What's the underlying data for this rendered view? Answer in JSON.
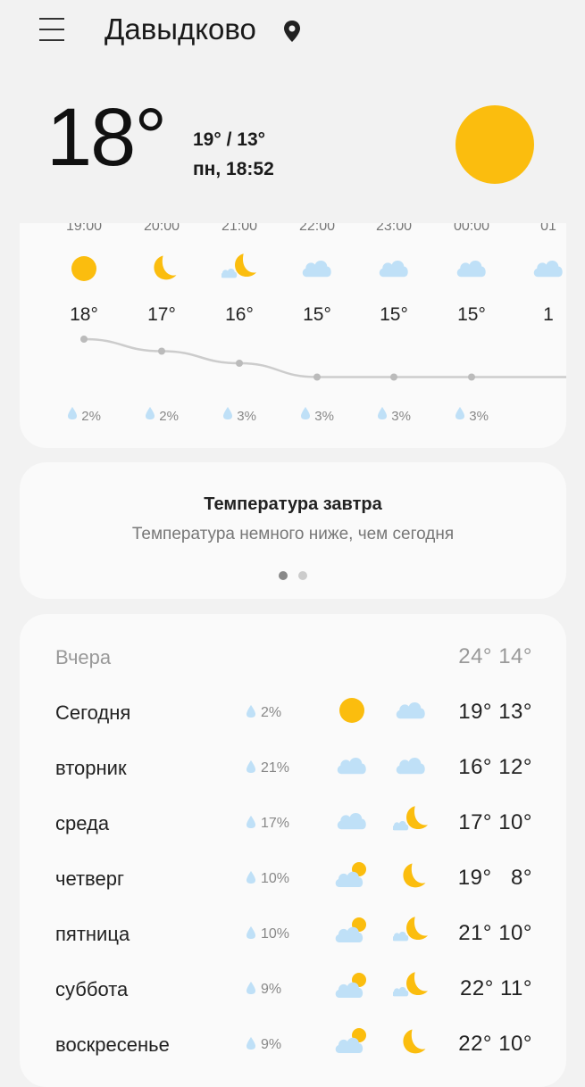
{
  "header": {
    "city": "Давыдково"
  },
  "current": {
    "temp": "18°",
    "hilo": "19° / 13°",
    "datetime": "пн, 18:52",
    "icon": "sun-icon"
  },
  "hourly": [
    {
      "time": "19:00",
      "icon": "sun",
      "temp": "18°",
      "precip": "2%"
    },
    {
      "time": "20:00",
      "icon": "moon",
      "temp": "17°",
      "precip": "2%"
    },
    {
      "time": "21:00",
      "icon": "moon-cloud",
      "temp": "16°",
      "precip": "3%"
    },
    {
      "time": "22:00",
      "icon": "cloud",
      "temp": "15°",
      "precip": "3%"
    },
    {
      "time": "23:00",
      "icon": "cloud",
      "temp": "15°",
      "precip": "3%"
    },
    {
      "time": "00:00",
      "icon": "cloud",
      "temp": "15°",
      "precip": "3%"
    },
    {
      "time": "01",
      "icon": "cloud",
      "temp": "1",
      "precip": ""
    }
  ],
  "tip": {
    "title": "Температура завтра",
    "subtitle": "Температура немного ниже, чем сегодня"
  },
  "daily": [
    {
      "name": "Вчера",
      "precip": "",
      "icon_day": "",
      "icon_night": "",
      "temps": "24° 14°"
    },
    {
      "name": "Сегодня",
      "precip": "2%",
      "icon_day": "sun",
      "icon_night": "cloud",
      "temps": "19° 13°"
    },
    {
      "name": "вторник",
      "precip": "21%",
      "icon_day": "cloud",
      "icon_night": "cloud",
      "temps": "16° 12°"
    },
    {
      "name": "среда",
      "precip": "17%",
      "icon_day": "cloud",
      "icon_night": "moon-cloud",
      "temps": "17° 10°"
    },
    {
      "name": "четверг",
      "precip": "10%",
      "icon_day": "sun-cloud",
      "icon_night": "moon",
      "temps": "19°   8°"
    },
    {
      "name": "пятница",
      "precip": "10%",
      "icon_day": "sun-cloud",
      "icon_night": "moon-cloud",
      "temps": "21° 10°"
    },
    {
      "name": "суббота",
      "precip": "9%",
      "icon_day": "sun-cloud",
      "icon_night": "moon-cloud",
      "temps": "22° 11°"
    },
    {
      "name": "воскресенье",
      "precip": "9%",
      "icon_day": "sun-cloud",
      "icon_night": "moon",
      "temps": "22° 10°"
    }
  ],
  "colors": {
    "sun": "#fbbd0e",
    "cloud": "#bfe0f7",
    "drop": "#bfe0f7",
    "line": "#cccccc"
  }
}
